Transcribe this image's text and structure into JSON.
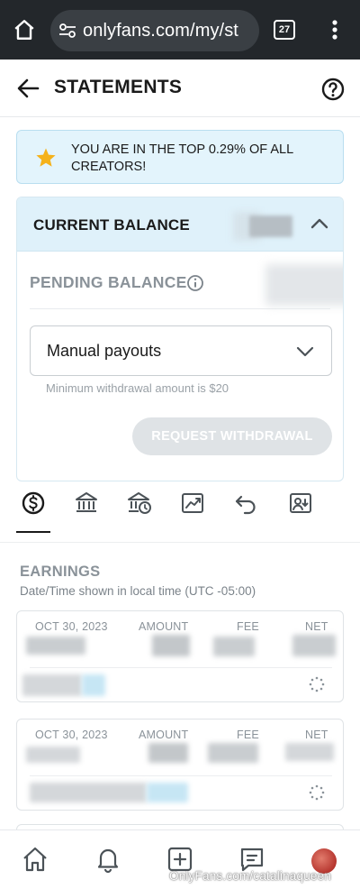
{
  "browser": {
    "url": "onlyfans.com/my/st",
    "tab_count": "27",
    "icons": {
      "home": "home-icon",
      "site_settings": "tune-icon",
      "menu": "more-vert-icon"
    }
  },
  "header": {
    "title": "STATEMENTS",
    "icons": {
      "back": "arrow-back-icon",
      "help": "help-circle-icon"
    }
  },
  "banner": {
    "text": "YOU ARE IN THE TOP 0.29% OF ALL CREATORS!",
    "icon": "star-icon",
    "colors": {
      "star": "#f5b21b",
      "background": "#e3f4fc"
    }
  },
  "balance": {
    "current_label": "CURRENT BALANCE",
    "pending_label": "PENDING BALANCE",
    "payout_selected": "Manual payouts",
    "min_note": "Minimum withdrawal amount is $20",
    "withdraw_button": "REQUEST WITHDRAWAL"
  },
  "tabs": [
    {
      "name": "earnings",
      "icon": "dollar-circle-icon",
      "active": true
    },
    {
      "name": "bank",
      "icon": "bank-icon",
      "active": false
    },
    {
      "name": "payout-requests",
      "icon": "bank-clock-icon",
      "active": false
    },
    {
      "name": "statistics",
      "icon": "chart-icon",
      "active": false
    },
    {
      "name": "refunds",
      "icon": "undo-icon",
      "active": false
    },
    {
      "name": "referrals",
      "icon": "user-card-icon",
      "active": false
    }
  ],
  "earnings": {
    "title": "EARNINGS",
    "subtitle": "Date/Time shown in local time (UTC -05:00)",
    "columns": {
      "amount": "AMOUNT",
      "fee": "FEE",
      "net": "NET"
    },
    "rows": [
      {
        "date": "OCT 30, 2023",
        "status_icon": "pending-spinner-icon"
      },
      {
        "date": "OCT 30, 2023",
        "status_icon": "pending-spinner-icon"
      }
    ]
  },
  "bottom_nav": {
    "items": [
      "home-icon",
      "bell-icon",
      "add-post-icon",
      "messages-icon",
      "avatar"
    ]
  },
  "watermark": "OnlyFans.com/catalinaqueen",
  "colors": {
    "accent": "#00aff0",
    "text": "#1a1a1a",
    "muted": "#8a9299"
  }
}
